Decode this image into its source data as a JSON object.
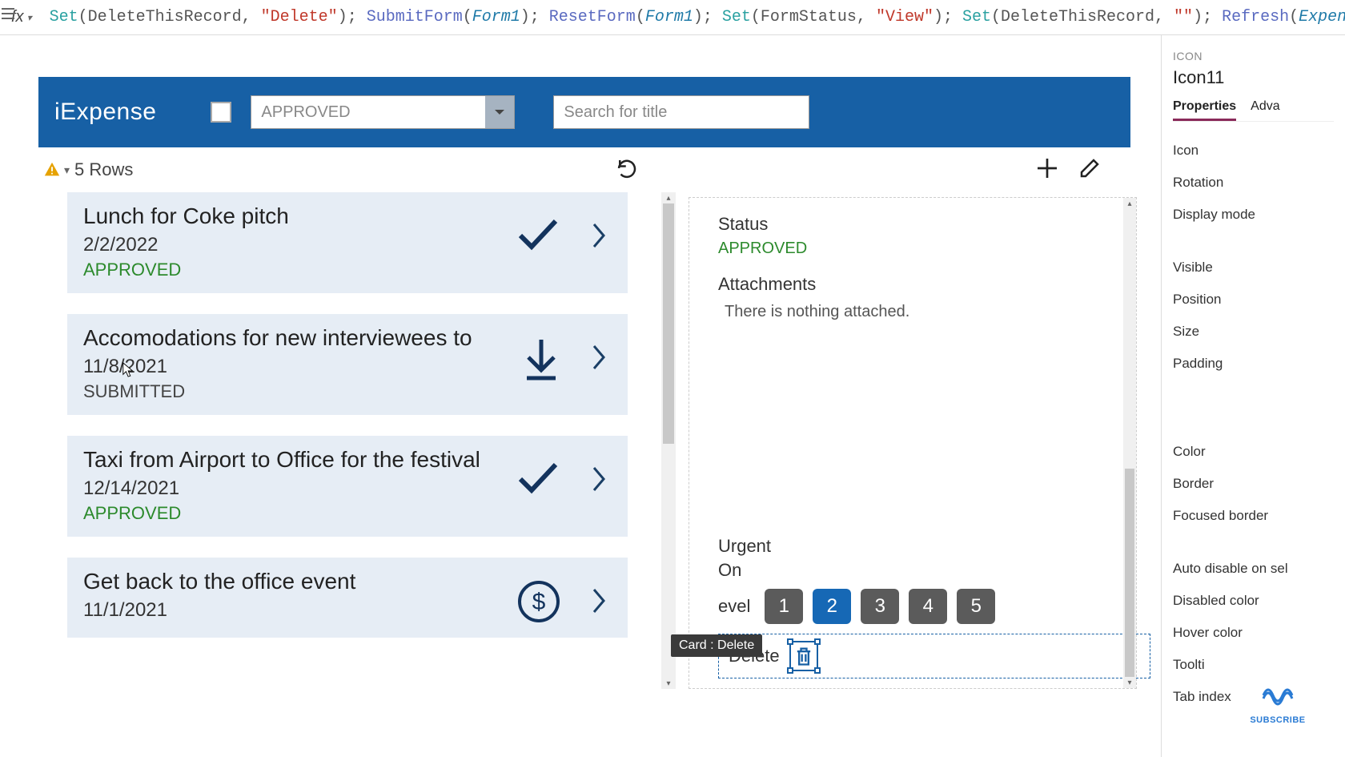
{
  "formula": {
    "tokens": [
      {
        "t": "Set",
        "c": "tok-fn"
      },
      {
        "t": "(",
        "c": "tok-punc"
      },
      {
        "t": "DeleteThisRecord",
        "c": "tok-var"
      },
      {
        "t": ", ",
        "c": "tok-punc"
      },
      {
        "t": "\"Delete\"",
        "c": "tok-str"
      },
      {
        "t": "); ",
        "c": "tok-punc"
      },
      {
        "t": "SubmitForm",
        "c": "tok-fn2"
      },
      {
        "t": "(",
        "c": "tok-punc"
      },
      {
        "t": "Form1",
        "c": "tok-arg"
      },
      {
        "t": "); ",
        "c": "tok-punc"
      },
      {
        "t": "ResetForm",
        "c": "tok-fn2"
      },
      {
        "t": "(",
        "c": "tok-punc"
      },
      {
        "t": "Form1",
        "c": "tok-arg"
      },
      {
        "t": "); ",
        "c": "tok-punc"
      },
      {
        "t": "Set",
        "c": "tok-fn"
      },
      {
        "t": "(",
        "c": "tok-punc"
      },
      {
        "t": "FormStatus",
        "c": "tok-var"
      },
      {
        "t": ", ",
        "c": "tok-punc"
      },
      {
        "t": "\"View\"",
        "c": "tok-str"
      },
      {
        "t": "); ",
        "c": "tok-punc"
      },
      {
        "t": "Set",
        "c": "tok-fn"
      },
      {
        "t": "(",
        "c": "tok-punc"
      },
      {
        "t": "DeleteThisRecord",
        "c": "tok-var"
      },
      {
        "t": ", ",
        "c": "tok-punc"
      },
      {
        "t": "\"\"",
        "c": "tok-str"
      },
      {
        "t": "); ",
        "c": "tok-punc"
      },
      {
        "t": "Refresh",
        "c": "tok-fn2"
      },
      {
        "t": "(",
        "c": "tok-punc"
      },
      {
        "t": "ExpensesSubmissions",
        "c": "tok-arg"
      },
      {
        "t": ")",
        "c": "tok-punc"
      }
    ]
  },
  "app": {
    "title": "iExpense",
    "dropdown_value": "APPROVED",
    "search_placeholder": "Search for title",
    "rows_label": "5 Rows"
  },
  "list": [
    {
      "title": "Lunch for Coke pitch",
      "date": "2/2/2022",
      "status": "APPROVED",
      "status_class": "status-approved",
      "icon": "check"
    },
    {
      "title": "Accomodations for new interviewees to",
      "date": "11/8/2021",
      "status": "SUBMITTED",
      "status_class": "status-submitted",
      "icon": "download"
    },
    {
      "title": "Taxi from Airport to Office for the festival",
      "date": "12/14/2021",
      "status": "APPROVED",
      "status_class": "status-approved",
      "icon": "check"
    },
    {
      "title": "Get back to the office event",
      "date": "11/1/2021",
      "status": "",
      "status_class": "",
      "icon": "dollar"
    }
  ],
  "detail": {
    "status_label": "Status",
    "status_value": "APPROVED",
    "attachments_label": "Attachments",
    "attachments_empty": "There is nothing attached.",
    "urgent_label": "Urgent",
    "urgent_value": "On",
    "level_label_partial": "evel",
    "rating_values": [
      "1",
      "2",
      "3",
      "4",
      "5"
    ],
    "rating_active_index": 1,
    "delete_label": "Delete",
    "tooltip": "Card : Delete"
  },
  "props": {
    "category": "ICON",
    "name": "Icon11",
    "tabs": {
      "active": "Properties",
      "other": "Adva"
    },
    "rows_group1": [
      "Icon",
      "Rotation",
      "Display mode"
    ],
    "rows_group2": [
      "Visible",
      "Position",
      "Size",
      "Padding"
    ],
    "rows_group3": [
      "Color",
      "Border",
      "Focused border"
    ],
    "rows_group4": [
      "Auto disable on sel",
      "Disabled color",
      "Hover color",
      "Toolti",
      "Tab index"
    ]
  },
  "subscribe": "SUBSCRIBE"
}
